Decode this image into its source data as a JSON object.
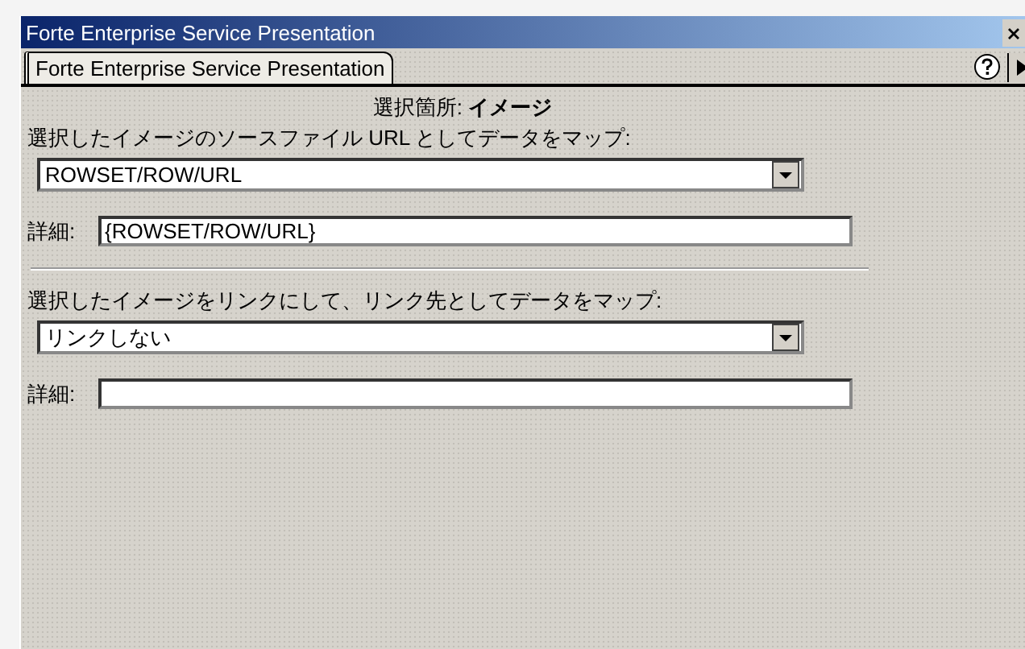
{
  "window": {
    "title": "Forte Enterprise Service Presentation"
  },
  "tabs": [
    {
      "label": "Forte Enterprise Service Presentation",
      "selected": true
    }
  ],
  "heading": "選択箇所: **イメージ**",
  "sections": [
    {
      "label": "選択したイメージのソースファイル URL としてデータをマップ:",
      "select": {
        "value": "ROWSET/ROW/URL"
      },
      "detail": {
        "label": "詳細:",
        "value": "{ROWSET/ROW/URL}"
      }
    },
    {
      "label": "選択したイメージをリンクにして、リンク先としてデータをマップ:",
      "select": {
        "value": "リンクしない"
      },
      "detail": {
        "label": "詳細:"
      }
    }
  ]
}
